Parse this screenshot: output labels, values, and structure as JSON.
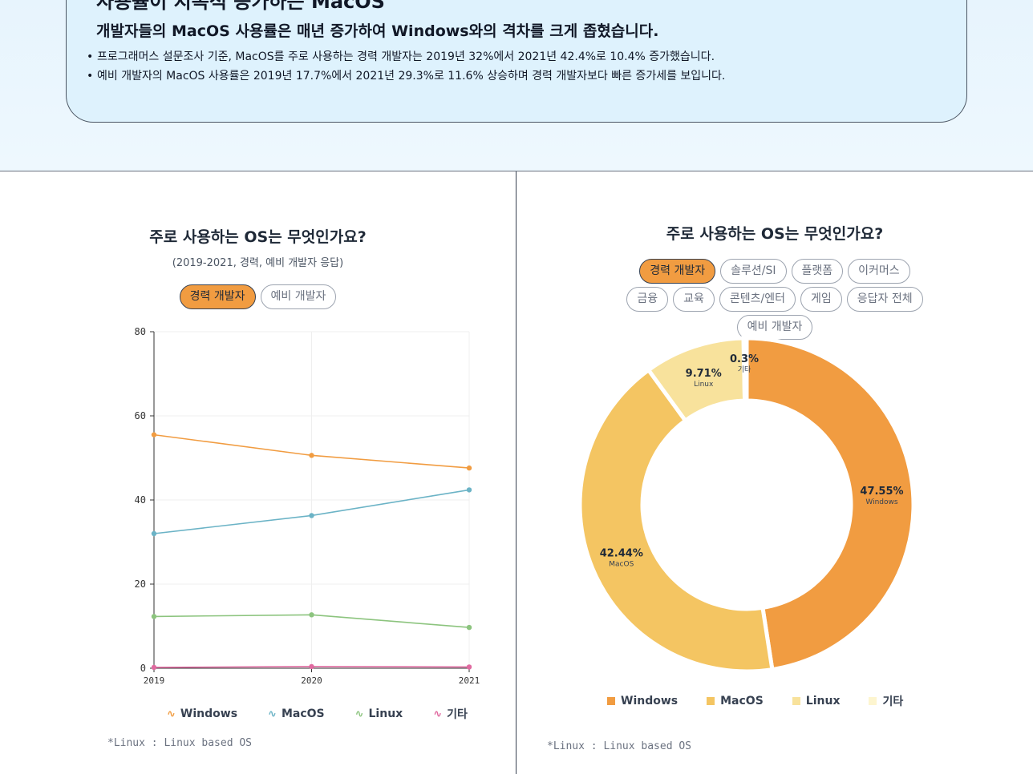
{
  "callout": {
    "title": "사용률이 지속적 증가하는 MacOS",
    "headline": "개발자들의 MacOS 사용률은 매년 증가하여 Windows와의 격차를 크게 좁혔습니다.",
    "bullets": [
      "프로그래머스 설문조사 기준, MacOS를 주로 사용하는 경력 개발자는 2019년 32%에서 2021년 42.4%로 10.4% 증가했습니다.",
      "예비 개발자의 MacOS 사용률은 2019년 17.7%에서 2021년 29.3%로 11.6% 상승하며 경력 개발자보다 빠른 증가세를 보입니다."
    ]
  },
  "left_panel": {
    "title": "주로 사용하는 OS는 무엇인가요?",
    "subtitle": "(2019-2021, 경력, 예비 개발자 응답)",
    "tabs": [
      "경력 개발자",
      "예비 개발자"
    ],
    "active_tab": "경력 개발자",
    "note": "*Linux : Linux based OS"
  },
  "right_panel": {
    "title": "주로 사용하는 OS는 무엇인가요?",
    "filters": [
      "경력 개발자",
      "솔루션/SI",
      "플랫폼",
      "이커머스",
      "금융",
      "교육",
      "콘텐츠/엔터",
      "게임",
      "응답자 전체",
      "예비 개발자"
    ],
    "active_filter": "경력 개발자",
    "note": "*Linux : Linux based OS"
  },
  "colors": {
    "Windows": "#f19c41",
    "MacOS": "#6bb3c6",
    "Linux": "#8cc47e",
    "기타": "#e06aa0",
    "donut_Windows": "#f19c41",
    "donut_MacOS": "#f4c562",
    "donut_Linux": "#f8e29c",
    "donut_기타": "#fdf5cf"
  },
  "chart_data": [
    {
      "type": "line",
      "x": [
        "2019",
        "2020",
        "2021"
      ],
      "ylim": [
        0,
        80
      ],
      "yticks": [
        0,
        20,
        40,
        60,
        80
      ],
      "grid": true,
      "legend": "bottom",
      "series": [
        {
          "name": "Windows",
          "values": [
            55.5,
            50.6,
            47.6
          ]
        },
        {
          "name": "MacOS",
          "values": [
            32.0,
            36.3,
            42.4
          ]
        },
        {
          "name": "Linux",
          "values": [
            12.3,
            12.7,
            9.7
          ]
        },
        {
          "name": "기타",
          "values": [
            0.2,
            0.4,
            0.3
          ]
        }
      ]
    },
    {
      "type": "pie",
      "donut": true,
      "legend": "bottom",
      "slices": [
        {
          "name": "Windows",
          "value": 47.55,
          "label": "47.55%"
        },
        {
          "name": "MacOS",
          "value": 42.44,
          "label": "42.44%"
        },
        {
          "name": "Linux",
          "value": 9.71,
          "label": "9.71%"
        },
        {
          "name": "기타",
          "value": 0.3,
          "label": "0.3%"
        }
      ]
    }
  ]
}
